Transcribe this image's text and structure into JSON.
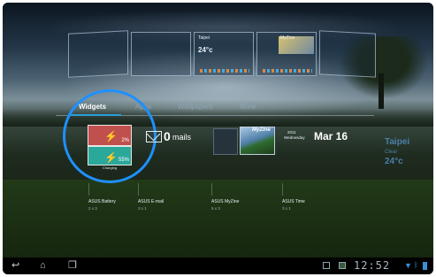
{
  "tabs": [
    {
      "label": "Widgets",
      "active": true
    },
    {
      "label": "Apps",
      "active": false
    },
    {
      "label": "Wallpapers",
      "active": false
    },
    {
      "label": "More",
      "active": false
    }
  ],
  "thumbnails": {
    "weather_city": "Taipei",
    "weather_temp": "24°c",
    "myzine_title": "MyZine"
  },
  "widgets": {
    "battery": {
      "caption": "Charging",
      "top_pct": "2%",
      "bottom_pct": "55%",
      "name": "ASUS Battery",
      "size": "2 x 3"
    },
    "email": {
      "count": "0",
      "unit": "mails",
      "name": "ASUS E-mail",
      "size": "3 x 1"
    },
    "myzine": {
      "title": "MyZine",
      "name": "ASUS MyZine",
      "size": "5 x 3"
    },
    "time": {
      "year": "2011",
      "weekday": "Wednesday",
      "date": "Mar 16",
      "name": "ASUS Time",
      "size": "3 x 1"
    }
  },
  "weather": {
    "city": "Taipei",
    "condition": "Clear",
    "temp": "24°c"
  },
  "navbar": {
    "back_icon": "back-icon",
    "home_icon": "home-icon",
    "recents_icon": "recent-apps-icon",
    "clock": "12:52"
  },
  "colors": {
    "accent": "#2a9fd6",
    "highlight": "#1e90ff",
    "battery_red": "#c0504d",
    "battery_teal": "#2aa89a"
  }
}
